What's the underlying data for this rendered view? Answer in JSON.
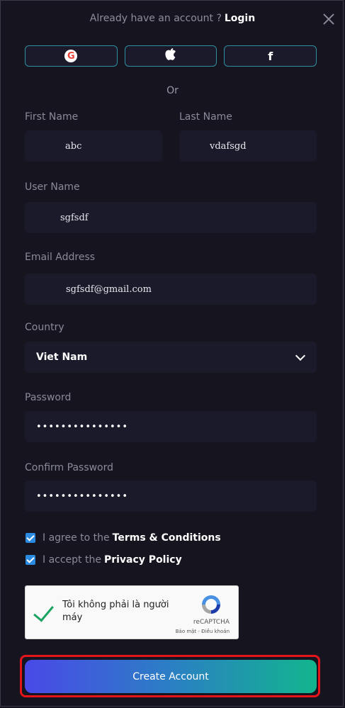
{
  "header": {
    "prompt": "Already have an account ?",
    "login_label": "Login"
  },
  "social": {
    "google_glyph": "G",
    "apple_glyph": "",
    "facebook_glyph": "f",
    "icons": [
      "google-icon",
      "apple-icon",
      "facebook-icon"
    ]
  },
  "divider_text": "Or",
  "form": {
    "first_name": {
      "label": "First Name",
      "value": "abc"
    },
    "last_name": {
      "label": "Last Name",
      "value": "vdafsgd"
    },
    "user_name": {
      "label": "User Name",
      "value": "sgfsdf"
    },
    "email": {
      "label": "Email Address",
      "value": "sgfsdf@gmail.com"
    },
    "country": {
      "label": "Country",
      "value": "Viet Nam"
    },
    "password": {
      "label": "Password",
      "value": "•••••••••••••••"
    },
    "confirm_password": {
      "label": "Confirm Password",
      "value": "•••••••••••••••"
    }
  },
  "agreements": {
    "terms_prefix": "I agree to the",
    "terms_link": "Terms & Conditions",
    "terms_checked": true,
    "privacy_prefix": "I accept the",
    "privacy_link": "Privacy Policy",
    "privacy_checked": true
  },
  "captcha": {
    "text": "Tôi không phải là người máy",
    "brand": "reCAPTCHA",
    "terms": "Bảo mật - Điều khoản",
    "checked": true
  },
  "submit_label": "Create Account",
  "colors": {
    "background": "#15141f",
    "field": "#1b1a2b",
    "accent_start": "#4a49e8",
    "accent_end": "#12b58e",
    "highlight_outline": "#e4141b",
    "checkbox": "#2a8be0"
  }
}
